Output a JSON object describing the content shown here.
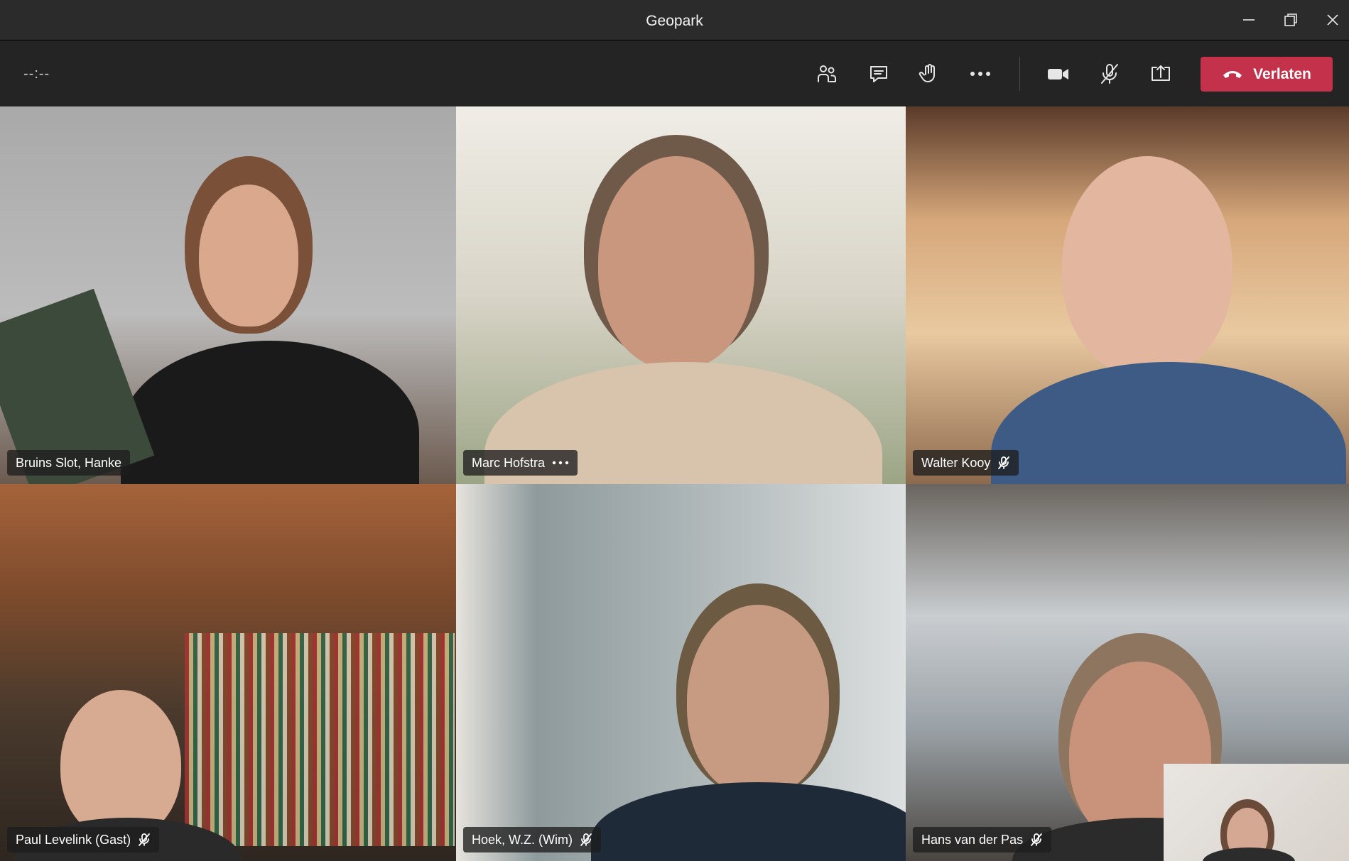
{
  "window": {
    "title": "Geopark"
  },
  "toolbar": {
    "timer": "--:--",
    "buttons": [
      {
        "icon": "participants-icon"
      },
      {
        "icon": "chat-icon"
      },
      {
        "icon": "raise-hand-icon"
      },
      {
        "icon": "more-options-icon"
      },
      {
        "icon": "camera-icon"
      },
      {
        "icon": "microphone-muted-icon"
      },
      {
        "icon": "share-screen-icon"
      }
    ],
    "leave_label": "Verlaten",
    "leave_color": "#c4314b"
  },
  "participants": [
    {
      "name": "Bruins Slot, Hanke",
      "muted": false,
      "more": false
    },
    {
      "name": "Marc Hofstra",
      "muted": false,
      "more": true
    },
    {
      "name": "Walter Kooy",
      "muted": true,
      "more": false
    },
    {
      "name": "Paul Levelink (Gast)",
      "muted": true,
      "more": false
    },
    {
      "name": "Hoek, W.Z. (Wim)",
      "muted": true,
      "more": false
    },
    {
      "name": "Hans van der Pas",
      "muted": true,
      "more": false
    }
  ]
}
